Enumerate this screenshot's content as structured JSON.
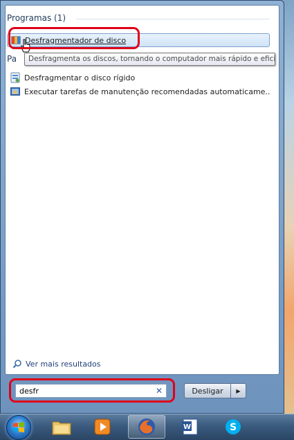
{
  "search_results": {
    "programs_header": "Programas (1)",
    "files_header_partial": "Pa",
    "programs": [
      {
        "label": "Desfragmentador de disco",
        "icon": "disk-defragmenter-icon"
      }
    ],
    "tooltip": "Desfragmenta os discos, tornando o computador mais rápido e eficiente.",
    "other_items": [
      {
        "label": "Desfragmentar o disco rígido",
        "icon": "defrag-settings-icon"
      },
      {
        "label": "Executar tarefas de manutenção recomendadas automaticame...",
        "icon": "maintenance-icon"
      }
    ],
    "see_more": "Ver mais resultados"
  },
  "search": {
    "value": "desfr"
  },
  "shutdown": {
    "label": "Desligar"
  },
  "taskbar": {
    "items": [
      {
        "name": "windows-explorer",
        "icon": "folder-icon"
      },
      {
        "name": "media-player",
        "icon": "media-player-icon"
      },
      {
        "name": "firefox",
        "icon": "firefox-icon"
      },
      {
        "name": "word",
        "icon": "word-icon"
      },
      {
        "name": "skype",
        "icon": "skype-icon"
      }
    ]
  },
  "colors": {
    "highlight_border": "#7da2ce",
    "callout_red": "#e0001a",
    "header_text": "#1e395b"
  }
}
